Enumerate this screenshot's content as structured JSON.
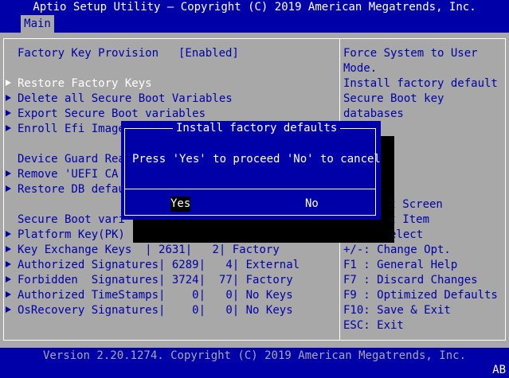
{
  "header": {
    "title": "Aptio Setup Utility – Copyright (C) 2019 American Megatrends, Inc.",
    "tab": "Main"
  },
  "main": {
    "factory_key_label": "Factory Key Provision",
    "factory_key_value": "[Enabled]",
    "restore_factory_keys": "Restore Factory Keys",
    "delete_all": "Delete all Secure Boot Variables",
    "export": "Export Secure Boot variables",
    "enroll": "Enroll Efi Image",
    "device_guard": "Device Guard Rea",
    "remove_uefi": "Remove 'UEFI CA'",
    "restore_db": "Restore DB defau",
    "secure_boot_vars": "Secure Boot vari",
    "platform_key": "Platform Key(PK)",
    "rows": [
      {
        "name": "Key Exchange Keys  ",
        "size": " 2631",
        "count": "   2",
        "source": "Factory"
      },
      {
        "name": "Authorized Signatures",
        "size": " 6289",
        "count": "   4",
        "source": "External"
      },
      {
        "name": "Forbidden  Signatures",
        "size": " 3724",
        "count": "  77",
        "source": "Factory"
      },
      {
        "name": "Authorized TimeStamps",
        "size": "    0",
        "count": "   0",
        "source": "No Keys"
      },
      {
        "name": "OsRecovery Signatures",
        "size": "    0",
        "count": "   0",
        "source": "No Keys"
      }
    ]
  },
  "help": {
    "lines": [
      "Force System to User",
      "Mode.",
      "Install factory default",
      "Secure Boot key",
      "databases"
    ]
  },
  "keys": {
    "select_screen": "ct Screen",
    "select_item": "ct Item",
    "select": "elect",
    "change": "+/-: Change Opt.",
    "general_help": "F1 : General Help",
    "discard": "F7 : Discard Changes",
    "optimized": "F9 : Optimized Defaults",
    "save_exit": "F10: Save & Exit",
    "esc": "ESC: Exit"
  },
  "dialog": {
    "title": "Install factory defaults",
    "message": "Press 'Yes' to proceed 'No' to cancel",
    "yes": "Yes",
    "no": "No"
  },
  "footer": {
    "version": "Version 2.20.1274. Copyright (C) 2019 American Megatrends, Inc.",
    "tag": "AB"
  },
  "colors": {
    "blue": "#0000a8",
    "gray": "#a8a8a8",
    "white": "#ffffff"
  }
}
